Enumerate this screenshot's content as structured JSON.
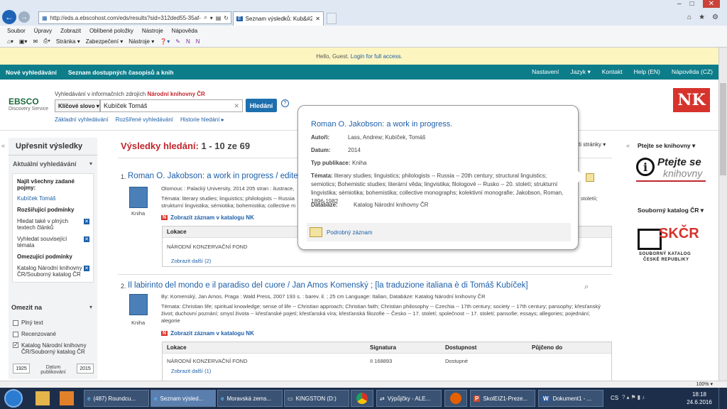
{
  "browser": {
    "url": "http://eds.a.ebscohost.com/eds/results?sid=312ded55-35af-4c18-ba",
    "tab_title": "Seznam výsledků: Kub&#23...",
    "menu": [
      "Soubor",
      "Úpravy",
      "Zobrazit",
      "Oblíbené položky",
      "Nástroje",
      "Nápověda"
    ],
    "cmd": [
      "Stránka ▾",
      "Zabezpečení ▾",
      "Nástroje ▾"
    ]
  },
  "guest": {
    "hello": "Hello, Guest.",
    "login": "Login for full access."
  },
  "topnav": {
    "left": [
      "Nové vyhledávání",
      "Seznam dostupných časopisů a knih"
    ],
    "right": [
      "Nastavení",
      "Jazyk ▾",
      "Kontakt",
      "Help (EN)",
      "Nápověda (CZ)"
    ]
  },
  "header": {
    "logo": "EBSCO",
    "logo_sub": "Discovery Service",
    "search_in": "Vyhledávání v informačních zdrojích",
    "search_in_lib": "Národní knihovny ČR",
    "field": "Klíčové slovo ▾",
    "query": "Kubíček Tomáš",
    "search_btn": "Hledání",
    "links": [
      "Základní vyhledávání",
      "Rozšířené vyhledávání",
      "Historie hledání ▸"
    ],
    "nk_logo": "NK"
  },
  "left": {
    "title": "Upřesnit výsledky",
    "current": "Aktuální vyhledávání",
    "find_all": "Najít všechny zadané pojmy:",
    "term": "Kubíček Tomáš",
    "expanders": "Rozšiřující podmínky",
    "exp1": "Hledat také v plných textech článků",
    "exp2": "Vyhledat související témata",
    "limiters": "Omezující podmínky",
    "lim1": "Katalog Národní knihovny ČR/Souborný katalog ČR",
    "limit_to": "Omezit na",
    "cb1": "Plný text",
    "cb2": "Recenzované",
    "cb3": "Katalog Národní knihovny ČR/Souborný katalog ČR",
    "year_from": "1925",
    "year_label": "Datum publikování",
    "year_to": "2015"
  },
  "results": {
    "label": "Výsledky hledání:",
    "range": "1 - 10 ze 69",
    "page_opts": "ti stránky ▾",
    "r1": {
      "num": "1.",
      "title": "Roman O. Jakobson: a work in progress / edite",
      "line1": "Olomouc : Palacký University, 2014 205 stran : ilustrace,",
      "line2": "Témata: literary studies; linguistics; philologists -- Russia",
      "line3": "strukturní lingvistika; sémiotika; bohemistika; collective m",
      "tail2": "stoletíi;",
      "type": "Kniha",
      "catalog": "Zobrazit záznam v katalogu NK",
      "loc_head": "Lokace",
      "loc": "NÁRODNÍ KONZERVAČNÍ FOND",
      "more": "Zobrazit další (2)"
    },
    "r2": {
      "num": "2.",
      "title": "Il labirinto del mondo e il paradiso del cuore / Jan Amos Komenský ; [la traduzione italiana è di Tomáš Kubíček]",
      "line1": "By: Komenský, Jan Amos. Praga : Wald Press, 2007 193 s. : barev. il. ; 25 cm Language: Italian, Databáze: Katalog Národní knihovny ČR",
      "line2": "Témata: Christian life; spiritual knowledge; sense of life -- Christian approach; Christian faith; Christian philosophy -- Czechia -- 17th century; society -- 17th century; pansophy; křesťanský",
      "line3": "život; duchovní poznání; smysl života -- křesťanské pojetí; křesťanská víra; křesťanská filozofie -- Česko -- 17. století; společnost -- 17. století; pansofie; essays; allegories; pojednání;",
      "line4": "alegorie",
      "type": "Kniha",
      "catalog": "Zobrazit záznam v katalogu NK",
      "cols": [
        "Lokace",
        "Signatura",
        "Dostupnost",
        "Půjčeno do"
      ],
      "loc": "NÁRODNÍ KONZERVAČNÍ FOND",
      "sig": "II 168893",
      "avail": "Dostupné",
      "more": "Zobrazit další (1)"
    }
  },
  "popup": {
    "title": "Roman O. Jakobson: a work in progress.",
    "authors_l": "Autoři:",
    "authors": "Lass, Andrew; Kubíček, Tomáš",
    "date_l": "Datum:",
    "date": "2014",
    "type_l": "Typ publikace:",
    "type": "Kniha",
    "topics_l": "Témata:",
    "topics": "literary studies; linguistics; philologists -- Russia -- 20th century; structural linguistics; semiotics; Bohemistic studies; literární věda; lingvistika; filologové -- Rusko -- 20. století; strukturní lingvistika; sémiotika; bohemistika; collective monographs; kolektivní monografie; Jakobson, Roman, 1896-1982",
    "db_l": "Databáze:",
    "db": "Katalog Národní knihovny ČR",
    "detail": "Podrobný záznam"
  },
  "right": {
    "ask": "Ptejte se knihovny ▾",
    "ask_logo1": "Ptejte se",
    "ask_logo2": "knihovny",
    "catalog": "Souborný katalog ČR ▾",
    "skc": "SKČR",
    "skc_sub1": "SOUBORNÝ KATALOG",
    "skc_sub2": "ČESKÉ REPUBLIKY"
  },
  "status": {
    "zoom": "100% ▾"
  },
  "taskbar": {
    "items": [
      "(487) Roundcu...",
      "Seznam výsled...",
      "Moravská zems...",
      "KINGSTON (D:)",
      "",
      "Výpůjčky - ALE...",
      "",
      "SkolEIZ1-Preze...",
      "Dokument1 - ..."
    ],
    "lang": "CS",
    "time": "18:18",
    "date": "24.6.2016"
  }
}
